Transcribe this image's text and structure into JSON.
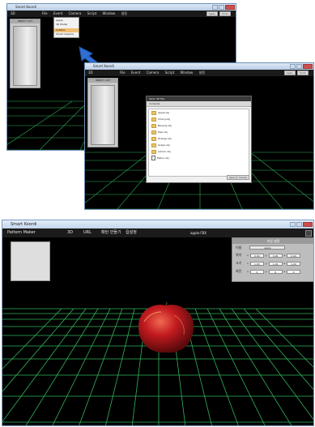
{
  "back_window": {
    "title": "Smart Koordi",
    "menu": [
      "3D",
      "File",
      "Event",
      "Camera",
      "Script",
      "Window",
      "설정"
    ],
    "panel_label": "OBJECT LIST",
    "right_buttons": [
      "Apply",
      "Undo"
    ],
    "dropdown_items": [
      "Apple",
      "3D Model",
      "Softskin",
      "Smart Capture"
    ]
  },
  "front_window": {
    "title": "Smart Koordi",
    "menu": [
      "3D",
      "File",
      "Event",
      "Camera",
      "Script",
      "Window",
      "설정"
    ],
    "panel_label": "OBJECT LIST",
    "right_buttons": [
      "Apply",
      "Undo"
    ],
    "dialog": {
      "title": "Open 3D File",
      "path": "Contents",
      "items": [
        "Apple.obj",
        "Cherry.obj",
        "Banana.obj",
        "Pear.obj",
        "Orange.obj",
        "Grape.obj",
        "Lemon.obj",
        "Melon.obj"
      ],
      "buttons": [
        "Open",
        "Cancel"
      ]
    }
  },
  "main_window": {
    "title": "Smart Koordi",
    "menu": [
      "Pattern Maker",
      "3D",
      "URL",
      "패턴 만들기",
      "컵설정"
    ],
    "object_name": "apple.FBX",
    "properties_panel": {
      "title": "속성 설정",
      "name_label": "이름",
      "name_value": "apple",
      "rows": [
        {
          "label": "위치",
          "x_label": "x",
          "x": "0.00",
          "y_label": "y",
          "y": "0.00",
          "z_label": "z",
          "z": "0.00"
        },
        {
          "label": "크기",
          "x_label": "x",
          "x": "1.00",
          "y_label": "y",
          "y": "1.00",
          "z_label": "z",
          "z": "1.00"
        },
        {
          "label": "회전",
          "x_label": "x",
          "x": "0",
          "y_label": "y",
          "y": "0",
          "z_label": "z",
          "z": "0"
        }
      ]
    }
  },
  "colors": {
    "grid": "#3bd46a",
    "arrow": "#2f6fd1",
    "apple_red": "#c21a1f"
  }
}
